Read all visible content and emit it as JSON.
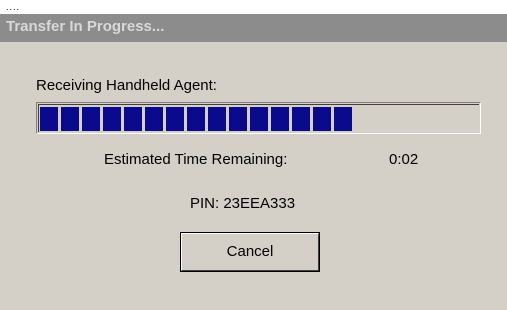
{
  "dialog": {
    "title": "Transfer In Progress...",
    "receiving_label": "Receiving Handheld Agent:",
    "progress_fraction": 0.77,
    "progress_chunks": 15,
    "estimated_label": "Estimated Time Remaining:",
    "estimated_value": "0:02",
    "pin_text": "PIN: 23EEA333",
    "cancel_label": "Cancel"
  },
  "colors": {
    "face": "#d4d0c8",
    "title_bar": "#8c8c8c",
    "progress_chunk": "#0a0a8c"
  }
}
